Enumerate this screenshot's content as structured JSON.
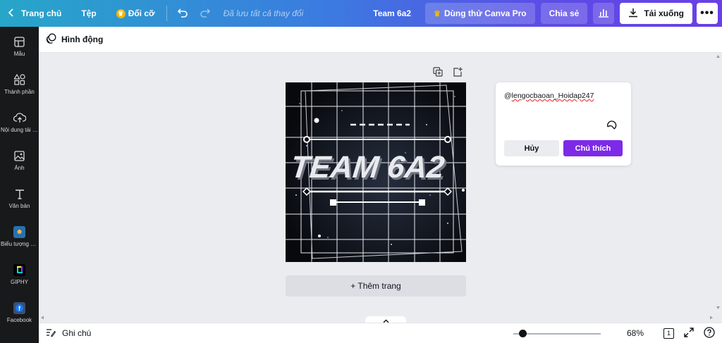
{
  "topbar": {
    "home_label": "Trang chủ",
    "file_label": "Tệp",
    "resize_label": "Đổi cỡ",
    "status": "Đã lưu tất cả thay đổi",
    "design_title": "Team 6a2",
    "try_pro_label": "Dùng thử Canva Pro",
    "share_label": "Chia sẻ",
    "download_label": "Tải xuống"
  },
  "sidebar": {
    "items": [
      {
        "label": "Mẫu",
        "icon": "template-icon"
      },
      {
        "label": "Thành phần",
        "icon": "elements-icon"
      },
      {
        "label": "Nội dung tải lên",
        "icon": "upload-icon"
      },
      {
        "label": "Ảnh",
        "icon": "photo-icon"
      },
      {
        "label": "Văn bản",
        "icon": "text-icon"
      },
      {
        "label": "Biểu tượng cảm xúc",
        "icon": "emoji-app-icon"
      },
      {
        "label": "GIPHY",
        "icon": "giphy-app-icon"
      },
      {
        "label": "Facebook",
        "icon": "facebook-app-icon"
      }
    ]
  },
  "subbar": {
    "animate_label": "Hình động"
  },
  "design": {
    "text": "TEAM 6A2"
  },
  "add_page_label": "+ Thêm trang",
  "comment": {
    "prefix": "@",
    "mention": "lengocbaoan_Hoidap247",
    "cancel_label": "Hủy",
    "submit_label": "Chú thích"
  },
  "bottombar": {
    "notes_label": "Ghi chú",
    "zoom": "68%",
    "page_count": "1",
    "zoom_fraction": 0.1
  },
  "colors": {
    "accent": "#7d2ae8",
    "sidebar_bg": "#18191b",
    "workspace_bg": "#ebecf0"
  }
}
